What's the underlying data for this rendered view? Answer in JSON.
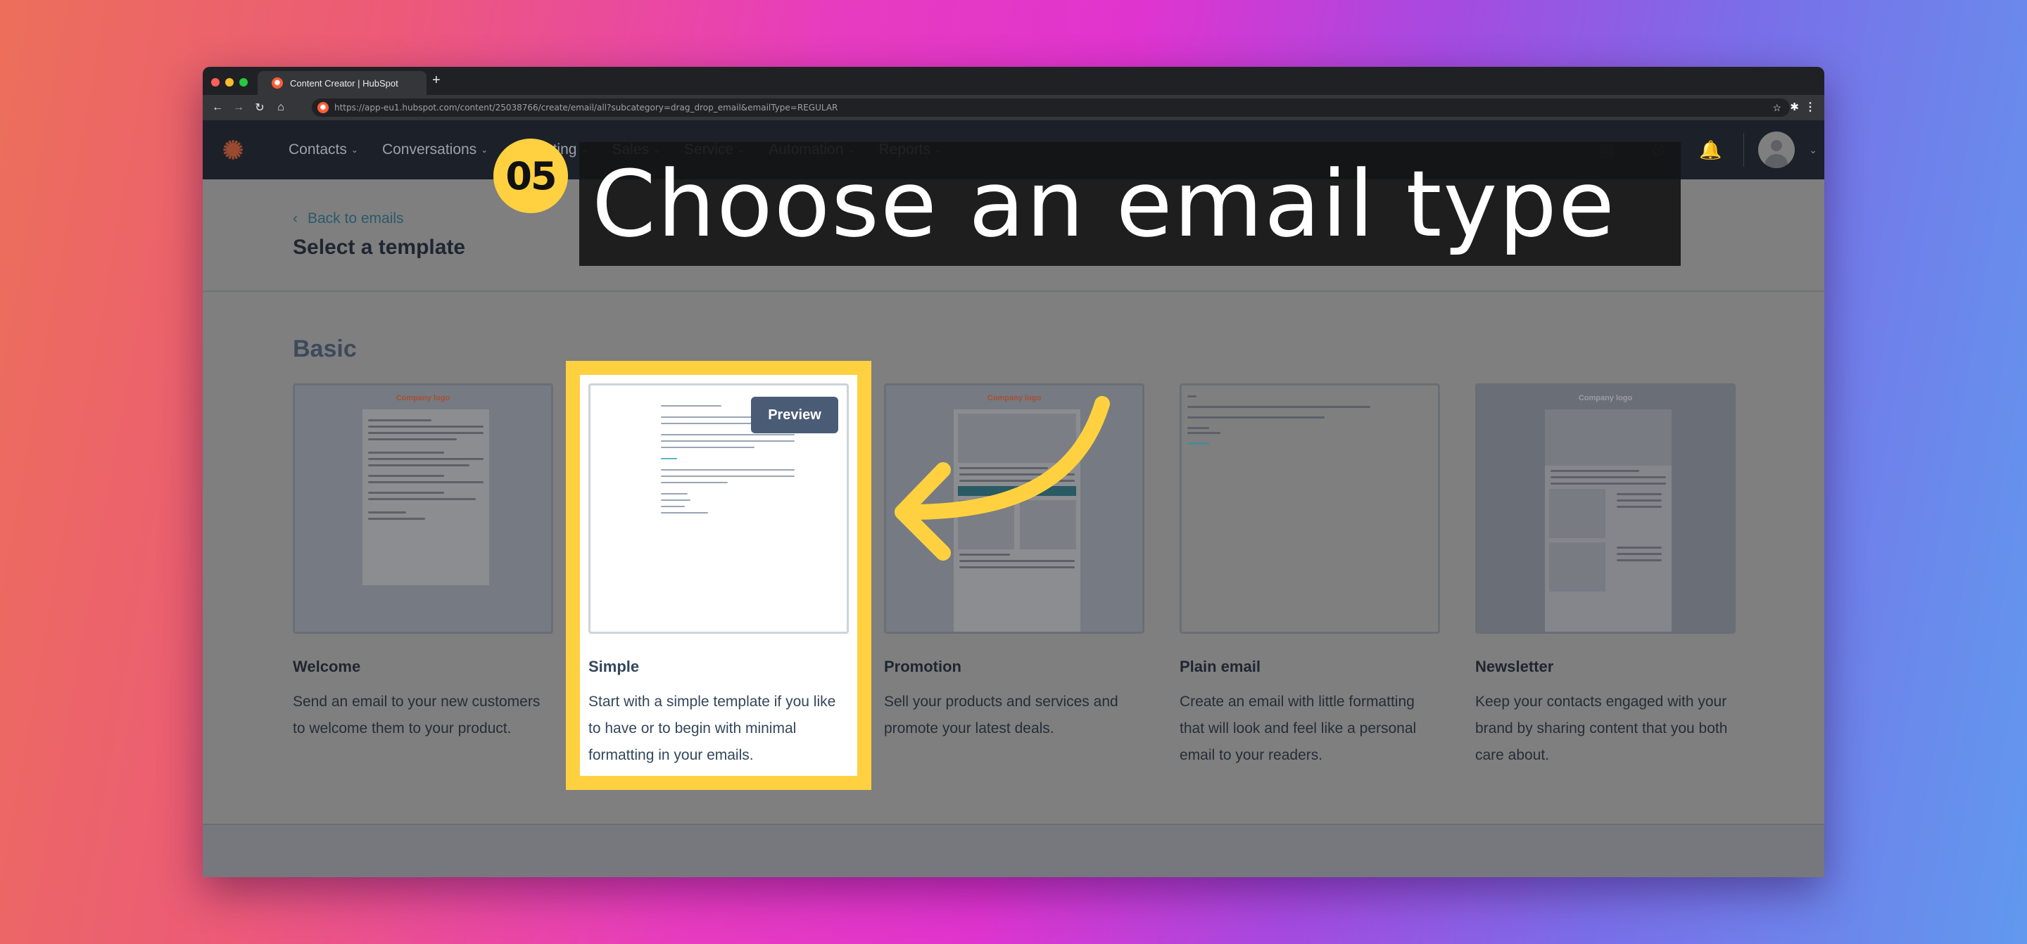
{
  "browser": {
    "tab_title": "Content Creator | HubSpot",
    "new_tab": "+",
    "url": "https://app-eu1.hubspot.com/content/25038766/create/email/all?subcategory=drag_drop_email&emailType=REGULAR",
    "nav": {
      "back": "←",
      "forward": "→",
      "reload": "↻",
      "home": "⌂"
    },
    "star": "☆",
    "extensions": "✱",
    "menu": "⋮"
  },
  "hubspot_nav": {
    "logo": "✺",
    "items": [
      {
        "label": "Contacts"
      },
      {
        "label": "Conversations"
      },
      {
        "label": "Marketing"
      },
      {
        "label": "Sales"
      },
      {
        "label": "Service"
      },
      {
        "label": "Automation"
      },
      {
        "label": "Reports"
      }
    ],
    "chevron": "⌄",
    "icons": {
      "search": "⌕",
      "marketplace": "▦",
      "settings": "⚙",
      "notifications": "🔔",
      "account_chevron": "⌄"
    }
  },
  "page": {
    "back_link": "Back to emails",
    "back_chevron": "‹",
    "title": "Select a template",
    "section": "Basic"
  },
  "templates": [
    {
      "title": "Welcome",
      "description": "Send an email to your new customers to welcome them to your product.",
      "thumb_logo": "Company logo"
    },
    {
      "title": "Simple",
      "description": "Start with a simple template if you like to have or to begin with minimal formatting in your emails.",
      "preview_label": "Preview",
      "highlighted": true
    },
    {
      "title": "Promotion",
      "description": "Sell your products and services and promote your latest deals.",
      "thumb_logo": "Company logo"
    },
    {
      "title": "Plain email",
      "description": "Create an email with little formatting that will look and feel like a personal email to your readers."
    },
    {
      "title": "Newsletter",
      "description": "Keep your contacts engaged with your brand by sharing content that you both care about.",
      "thumb_logo": "Company logo"
    }
  ],
  "annotation": {
    "step": "05",
    "caption": "Choose an email type",
    "accent": "#ffd140"
  }
}
